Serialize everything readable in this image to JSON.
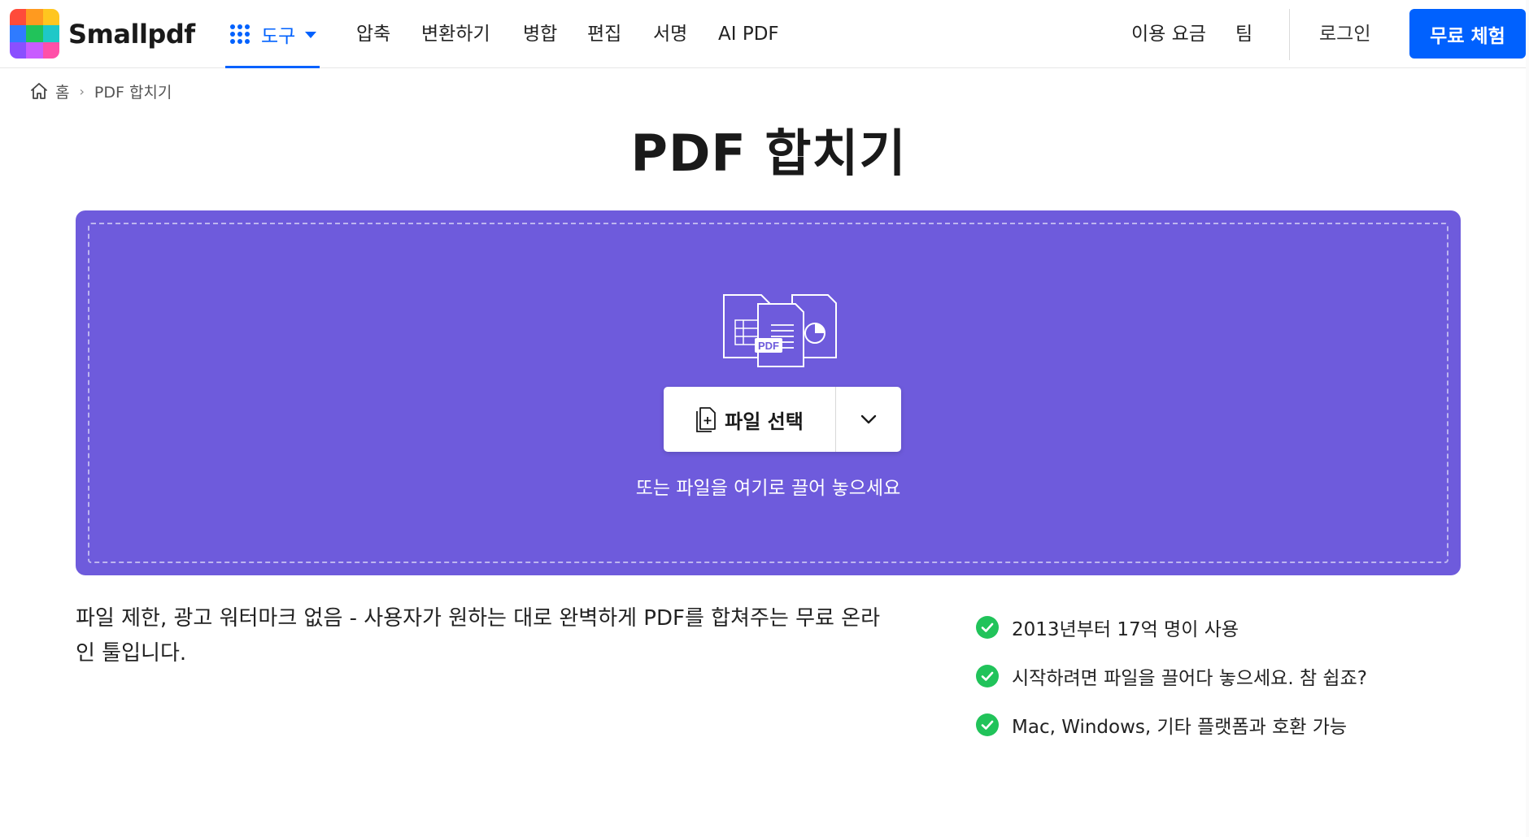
{
  "brand": {
    "name": "Smallpdf",
    "logo_colors": [
      "#ff3b30",
      "#ff9500",
      "#ffcc00",
      "#1ec8ff",
      "#34c759",
      "#00c7be",
      "#5856d6",
      "#af52de",
      "#ff2d92"
    ],
    "accent": "#0061fe",
    "dropzone_color": "#6e5bdc",
    "check_color": "#21c35a"
  },
  "nav": {
    "tools_label": "도구",
    "links": [
      "압축",
      "변환하기",
      "병합",
      "편집",
      "서명",
      "AI PDF"
    ],
    "pricing": "이용 요금",
    "team": "팀",
    "login": "로그인",
    "trial": "무료 체험"
  },
  "breadcrumb": {
    "home": "홈",
    "current": "PDF 합치기"
  },
  "page": {
    "title": "PDF 합치기"
  },
  "dropzone": {
    "doc_badge": "PDF",
    "select_button": "파일 선택",
    "hint": "또는 파일을 여기로 끌어 놓으세요"
  },
  "description": "파일 제한, 광고 워터마크 없음 - 사용자가 원하는 대로 완벽하게 PDF를 합쳐주는 무료 온라인 툴입니다.",
  "features": [
    "2013년부터 17억 명이 사용",
    "시작하려면 파일을 끌어다 놓으세요. 참 쉽죠?",
    "Mac, Windows, 기타 플랫폼과 호환 가능"
  ]
}
